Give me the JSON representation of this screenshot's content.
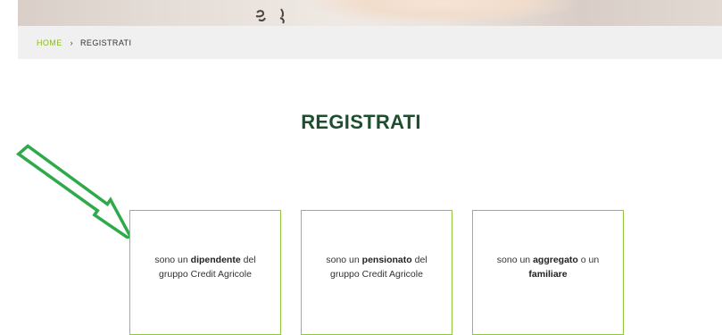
{
  "breadcrumb": {
    "home": "HOME",
    "separator": "›",
    "current": "REGISTRATI"
  },
  "title": "REGISTRATI",
  "cards": [
    {
      "pre": "sono un ",
      "bold": "dipendente",
      "post": " del",
      "line2": "gruppo Credit Agricole"
    },
    {
      "pre": "sono un ",
      "bold": "pensionato",
      "post": " del",
      "line2": "gruppo Credit Agricole"
    },
    {
      "pre": "sono un ",
      "bold": "aggregato",
      "post": " o un",
      "line2": "familiare"
    }
  ],
  "colors": {
    "accent": "#8cbb1c",
    "title": "#1d4e2d",
    "card_border": "#92c43c",
    "arrow": "#2eaa4a"
  },
  "annotation_icon": "arrow-icon"
}
